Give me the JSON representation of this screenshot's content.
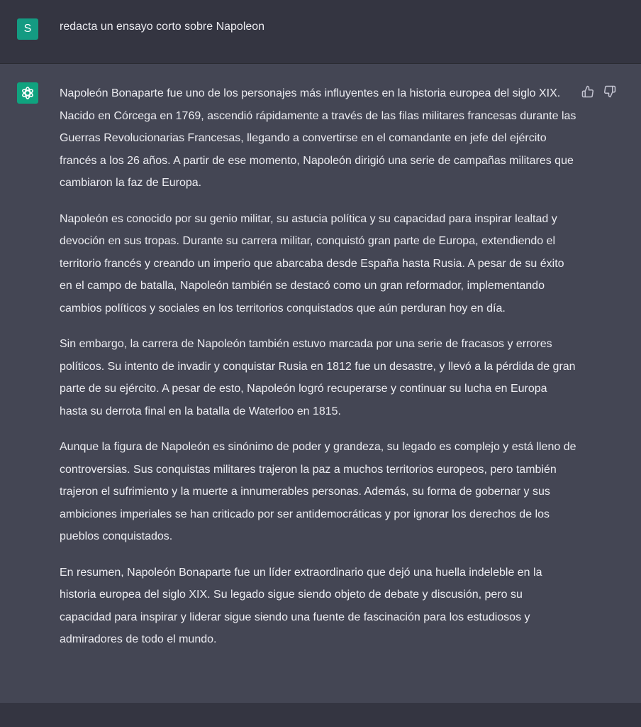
{
  "user_message": {
    "avatar_letter": "S",
    "text": "redacta un ensayo corto sobre Napoleon"
  },
  "assistant_message": {
    "paragraphs": [
      "Napoleón Bonaparte fue uno de los personajes más influyentes en la historia europea del siglo XIX. Nacido en Córcega en 1769, ascendió rápidamente a través de las filas militares francesas durante las Guerras Revolucionarias Francesas, llegando a convertirse en el comandante en jefe del ejército francés a los 26 años. A partir de ese momento, Napoleón dirigió una serie de campañas militares que cambiaron la faz de Europa.",
      "Napoleón es conocido por su genio militar, su astucia política y su capacidad para inspirar lealtad y devoción en sus tropas. Durante su carrera militar, conquistó gran parte de Europa, extendiendo el territorio francés y creando un imperio que abarcaba desde España hasta Rusia. A pesar de su éxito en el campo de batalla, Napoleón también se destacó como un gran reformador, implementando cambios políticos y sociales en los territorios conquistados que aún perduran hoy en día.",
      "Sin embargo, la carrera de Napoleón también estuvo marcada por una serie de fracasos y errores políticos. Su intento de invadir y conquistar Rusia en 1812 fue un desastre, y llevó a la pérdida de gran parte de su ejército. A pesar de esto, Napoleón logró recuperarse y continuar su lucha en Europa hasta su derrota final en la batalla de Waterloo en 1815.",
      "Aunque la figura de Napoleón es sinónimo de poder y grandeza, su legado es complejo y está lleno de controversias. Sus conquistas militares trajeron la paz a muchos territorios europeos, pero también trajeron el sufrimiento y la muerte a innumerables personas. Además, su forma de gobernar y sus ambiciones imperiales se han criticado por ser antidemocráticas y por ignorar los derechos de los pueblos conquistados.",
      "En resumen, Napoleón Bonaparte fue un líder extraordinario que dejó una huella indeleble en la historia europea del siglo XIX. Su legado sigue siendo objeto de debate y discusión, pero su capacidad para inspirar y liderar sigue siendo una fuente de fascinación para los estudiosos y admiradores de todo el mundo."
    ]
  },
  "feedback": {
    "thumbs_up_icon": "thumbs-up-icon",
    "thumbs_down_icon": "thumbs-down-icon"
  },
  "colors": {
    "user_bg": "#343541",
    "assistant_bg": "#444654",
    "user_avatar": "#149b82",
    "bot_avatar": "#10a37f"
  }
}
